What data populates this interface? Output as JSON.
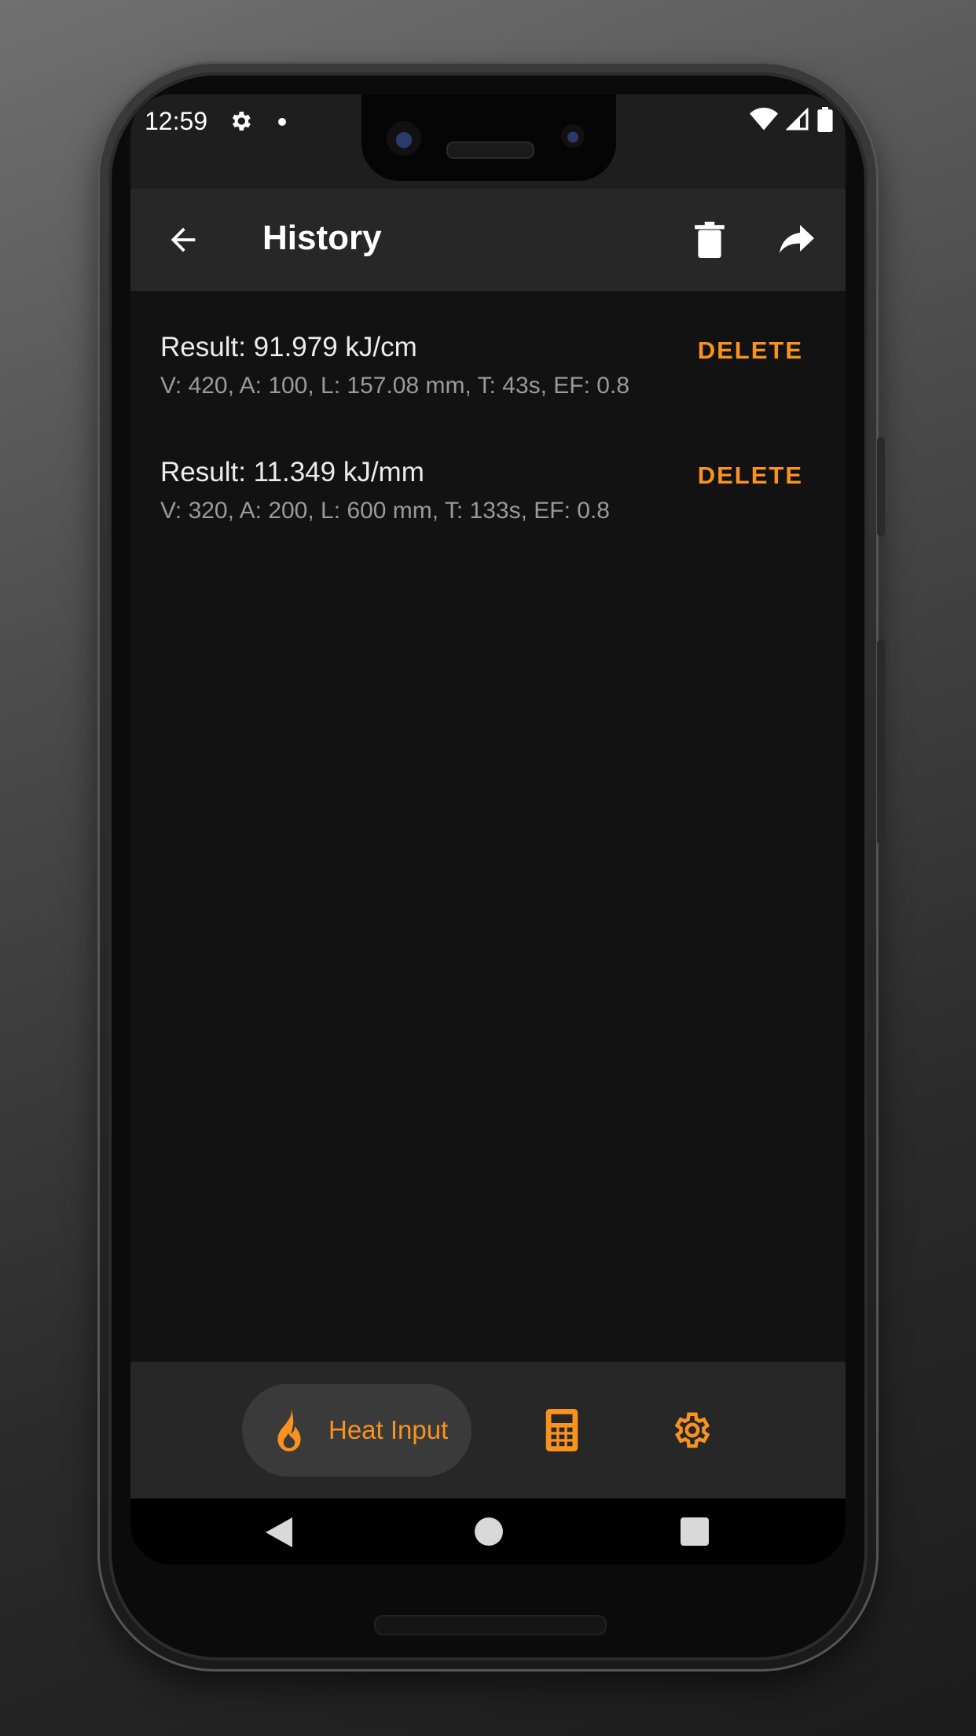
{
  "status_bar": {
    "time": "12:59"
  },
  "toolbar": {
    "title": "History"
  },
  "history": {
    "items": [
      {
        "result": "Result: 91.979 kJ/cm",
        "details": "V: 420, A: 100, L: 157.08 mm, T: 43s, EF: 0.8",
        "delete_label": "DELETE"
      },
      {
        "result": "Result: 11.349 kJ/mm",
        "details": "V: 320, A: 200, L: 600 mm, T: 133s, EF: 0.8",
        "delete_label": "DELETE"
      }
    ]
  },
  "bottom_nav": {
    "active_label": "Heat Input",
    "items": [
      "fire-icon",
      "calculator-icon",
      "gear-icon"
    ]
  },
  "colors": {
    "accent": "#f7931e",
    "background": "#121212",
    "toolbar": "#272727"
  }
}
